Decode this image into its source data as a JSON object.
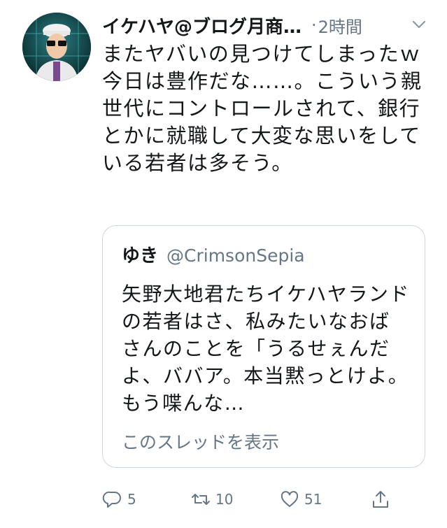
{
  "tweet": {
    "author": "イケハヤ@ブログ月商…",
    "separator": "·",
    "time": "2時間",
    "text": "またヤバいの見つけてしまったｗ 今日は豊作だな……。こういう親世代にコントロールされて、銀行とかに就職して大変な思いをしている若者は多そう。"
  },
  "quote": {
    "name": "ゆき",
    "handle": "@CrimsonSepia",
    "text": "矢野大地君たちイケハヤランドの若者はさ、私みたいなおばさんのことを「うるせぇんだよ、ババア。本当黙っとけよ。もう喋んな…",
    "thread_link": "このスレッドを表示"
  },
  "actions": {
    "reply_count": "5",
    "retweet_count": "10",
    "like_count": "51"
  },
  "icons": {
    "menu": "chevron-down-icon",
    "reply": "reply-icon",
    "retweet": "retweet-icon",
    "like": "heart-icon",
    "share": "share-icon"
  },
  "colors": {
    "text": "#14171a",
    "secondary": "#657786",
    "border": "#ccd6dd",
    "background": "#ffffff"
  }
}
